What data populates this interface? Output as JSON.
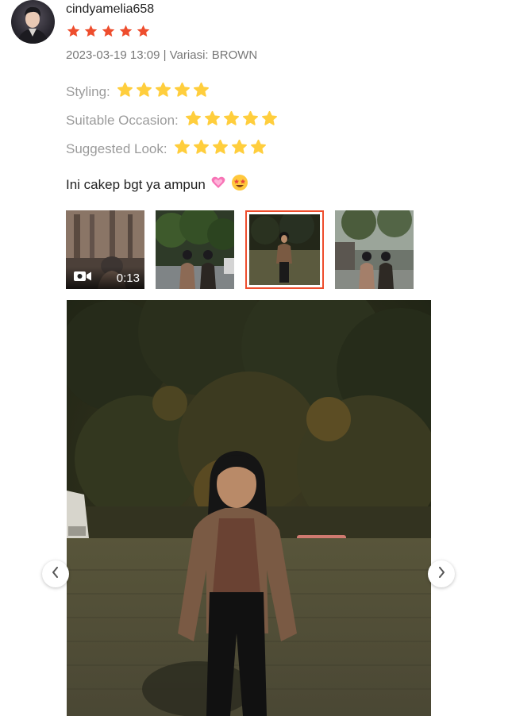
{
  "review": {
    "username": "cindyamelia658",
    "rating": 5,
    "meta": "2023-03-19 13:09 | Variasi: BROWN",
    "attributes": [
      {
        "label": "Styling:",
        "rating": 5
      },
      {
        "label": "Suitable Occasion:",
        "rating": 5
      },
      {
        "label": "Suggested Look:",
        "rating": 5
      }
    ],
    "comment": "Ini cakep bgt ya ampun",
    "comment_emojis": [
      "heart-pulse-emoji",
      "star-struck-emoji"
    ]
  },
  "media": {
    "thumbnails": [
      {
        "type": "video",
        "duration": "0:13",
        "icon": "video-camera-icon"
      },
      {
        "type": "photo"
      },
      {
        "type": "photo",
        "selected": true
      },
      {
        "type": "photo"
      }
    ],
    "selected_index": 2
  },
  "colors": {
    "rating_star": "#ee4d2d",
    "attribute_star": "#ffce3d",
    "selected_border": "#ee4d2d"
  },
  "icons": {
    "prev": "chevron-left-icon",
    "next": "chevron-right-icon"
  }
}
